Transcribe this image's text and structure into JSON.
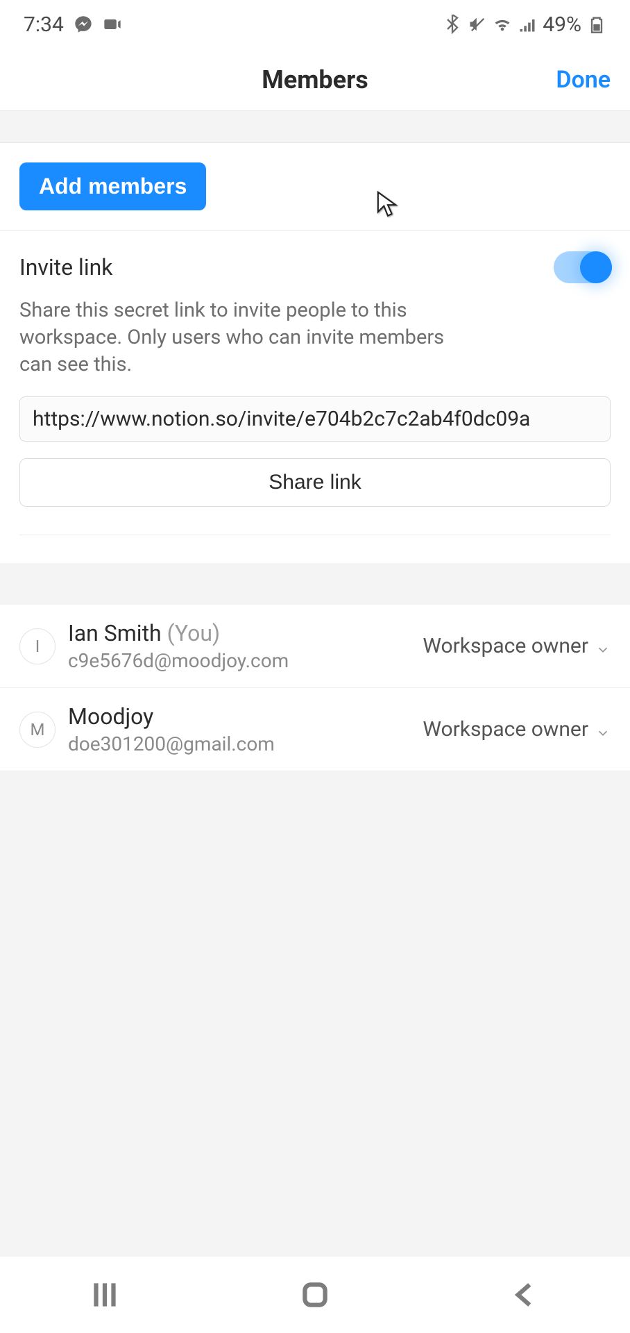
{
  "status": {
    "time": "7:34",
    "battery_text": "49%"
  },
  "header": {
    "title": "Members",
    "done": "Done"
  },
  "add_members": {
    "label": "Add members"
  },
  "invite": {
    "title": "Invite link",
    "description": "Share this secret link to invite people to this workspace. Only users who can invite members can see this.",
    "url": "https://www.notion.so/invite/e704b2c7c2ab4f0dc09a",
    "share_label": "Share link",
    "toggle_on": true
  },
  "members": [
    {
      "initial": "I",
      "name": "Ian Smith",
      "you_suffix": "(You)",
      "email": "c9e5676d@moodjoy.com",
      "role": "Workspace owner"
    },
    {
      "initial": "M",
      "name": "Moodjoy",
      "you_suffix": "",
      "email": "doe301200@gmail.com",
      "role": "Workspace owner"
    }
  ]
}
